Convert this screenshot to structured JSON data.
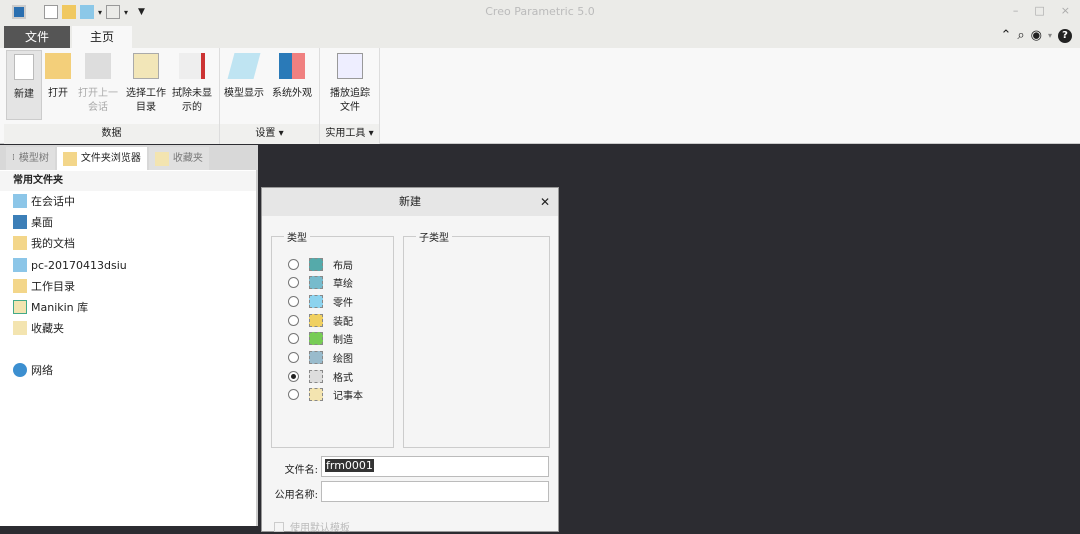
{
  "window": {
    "title": "Creo Parametric 5.0",
    "minimize": "–",
    "maximize": "□",
    "close": "×"
  },
  "tabs": {
    "file": "文件",
    "home": "主页"
  },
  "ribbon": {
    "groups": [
      {
        "label": "数据",
        "buttons": [
          {
            "label": "新建"
          },
          {
            "label": "打开"
          },
          {
            "label": "打开上一\n会话"
          },
          {
            "label": "选择工作\n目录"
          },
          {
            "label": "拭除未显\n示的"
          }
        ]
      },
      {
        "label": "设置 ▾",
        "buttons": [
          {
            "label": "模型显示"
          },
          {
            "label": "系统外观"
          }
        ]
      },
      {
        "label": "实用工具 ▾",
        "buttons": [
          {
            "label": "播放追踪\n文件"
          }
        ]
      }
    ]
  },
  "left_panel": {
    "tabs": [
      "模型树",
      "文件夹浏览器",
      "收藏夹"
    ],
    "header": "常用文件夹",
    "items": [
      "在会话中",
      "桌面",
      "我的文档",
      "pc-20170413dsiu",
      "工作目录",
      "Manikin 库",
      "收藏夹",
      "网络"
    ]
  },
  "dialog": {
    "title": "新建",
    "type_legend": "类型",
    "subtype_legend": "子类型",
    "types": [
      {
        "label": "布局",
        "selected": false
      },
      {
        "label": "草绘",
        "selected": false
      },
      {
        "label": "零件",
        "selected": false
      },
      {
        "label": "装配",
        "selected": false
      },
      {
        "label": "制造",
        "selected": false
      },
      {
        "label": "绘图",
        "selected": false
      },
      {
        "label": "格式",
        "selected": true
      },
      {
        "label": "记事本",
        "selected": false
      }
    ],
    "file_name_label": "文件名:",
    "file_name_value": "frm0001",
    "common_name_label": "公用名称:",
    "common_name_value": "",
    "use_template_label": "使用默认模板"
  }
}
